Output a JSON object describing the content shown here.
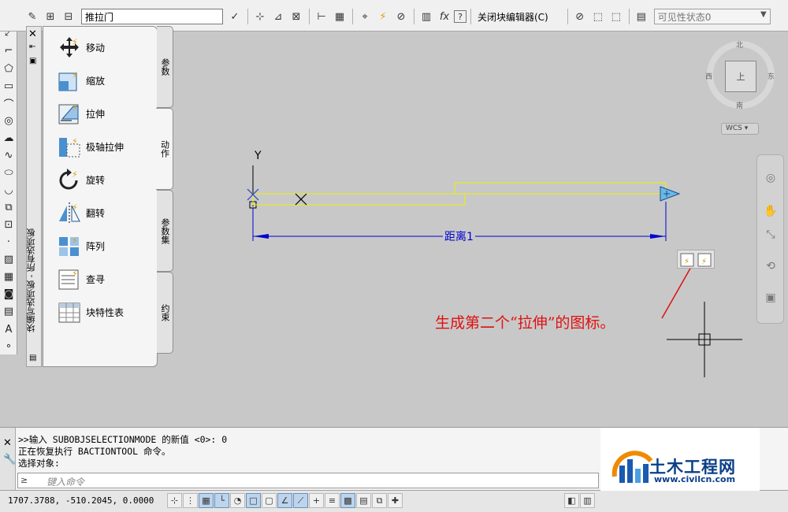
{
  "toolbar": {
    "block_name": "推拉门",
    "close_editor_label": "关闭块编辑器(C)",
    "visibility_select": "可见性状态0",
    "fx_label": "fx",
    "help_label": "?"
  },
  "palette": {
    "title": "块编写选项板 - 所有选项板",
    "items": [
      {
        "label": "移动",
        "icon": "move-icon"
      },
      {
        "label": "缩放",
        "icon": "scale-icon"
      },
      {
        "label": "拉伸",
        "icon": "stretch-icon"
      },
      {
        "label": "极轴拉伸",
        "icon": "polar-stretch-icon"
      },
      {
        "label": "旋转",
        "icon": "rotate-icon"
      },
      {
        "label": "翻转",
        "icon": "flip-icon"
      },
      {
        "label": "阵列",
        "icon": "array-icon"
      },
      {
        "label": "查寻",
        "icon": "lookup-icon"
      },
      {
        "label": "块特性表",
        "icon": "block-table-icon"
      }
    ],
    "tabs": [
      {
        "label": "参数",
        "active": false
      },
      {
        "label": "动作",
        "active": true
      },
      {
        "label": "参数集",
        "active": false
      },
      {
        "label": "约束",
        "active": false
      }
    ]
  },
  "canvas": {
    "y_axis_label": "Y",
    "dimension_text": "距离1",
    "annotation": "生成第二个“拉伸”的图标。",
    "annotation_color": "#e01010",
    "dimension_color": "#0000d0",
    "outline_color": "#f0f000"
  },
  "viewcube": {
    "north": "北",
    "south": "南",
    "east": "东",
    "west": "西",
    "face": "上",
    "wcs": "WCS"
  },
  "command": {
    "lines": [
      ">>输入 SUBOBJSELECTIONMODE 的新值 <0>: 0",
      "正在恢复执行 BACTIONTOOL 命令。",
      "选择对象:"
    ],
    "placeholder": "键入命令",
    "prompt_icon": "≥"
  },
  "status": {
    "coords": "1707.3788, -510.2045, 0.0000"
  },
  "logo": {
    "name": "土木工程网",
    "url": "www.civilcn.com"
  }
}
